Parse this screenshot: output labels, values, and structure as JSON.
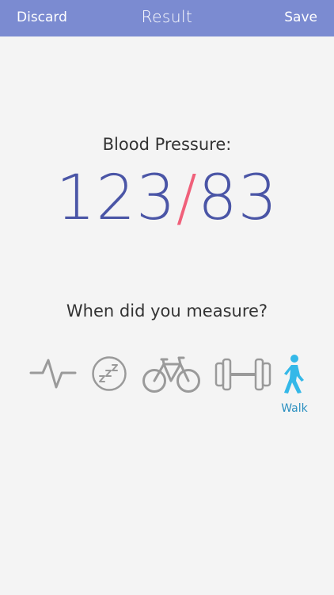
{
  "nav": {
    "discard_label": "Discard",
    "title": "Result",
    "save_label": "Save"
  },
  "colors": {
    "nav_background": "#7b8bd1",
    "value_color": "#4a55a6",
    "slash_color": "#f0607a",
    "icon_inactive": "#9a9a9a",
    "icon_active": "#34b8e8",
    "label_active": "#2a8fc0"
  },
  "measurement": {
    "label": "Blood Pressure:",
    "systolic": "123",
    "separator": "/",
    "diastolic": "83"
  },
  "question": "When did you measure?",
  "activities": [
    {
      "icon": "heartbeat-icon",
      "selected": false
    },
    {
      "icon": "sleep-icon",
      "selected": false
    },
    {
      "icon": "bicycle-icon",
      "selected": false
    },
    {
      "icon": "dumbbell-icon",
      "selected": false
    },
    {
      "icon": "walk-icon",
      "selected": true,
      "label": "Walk"
    }
  ]
}
